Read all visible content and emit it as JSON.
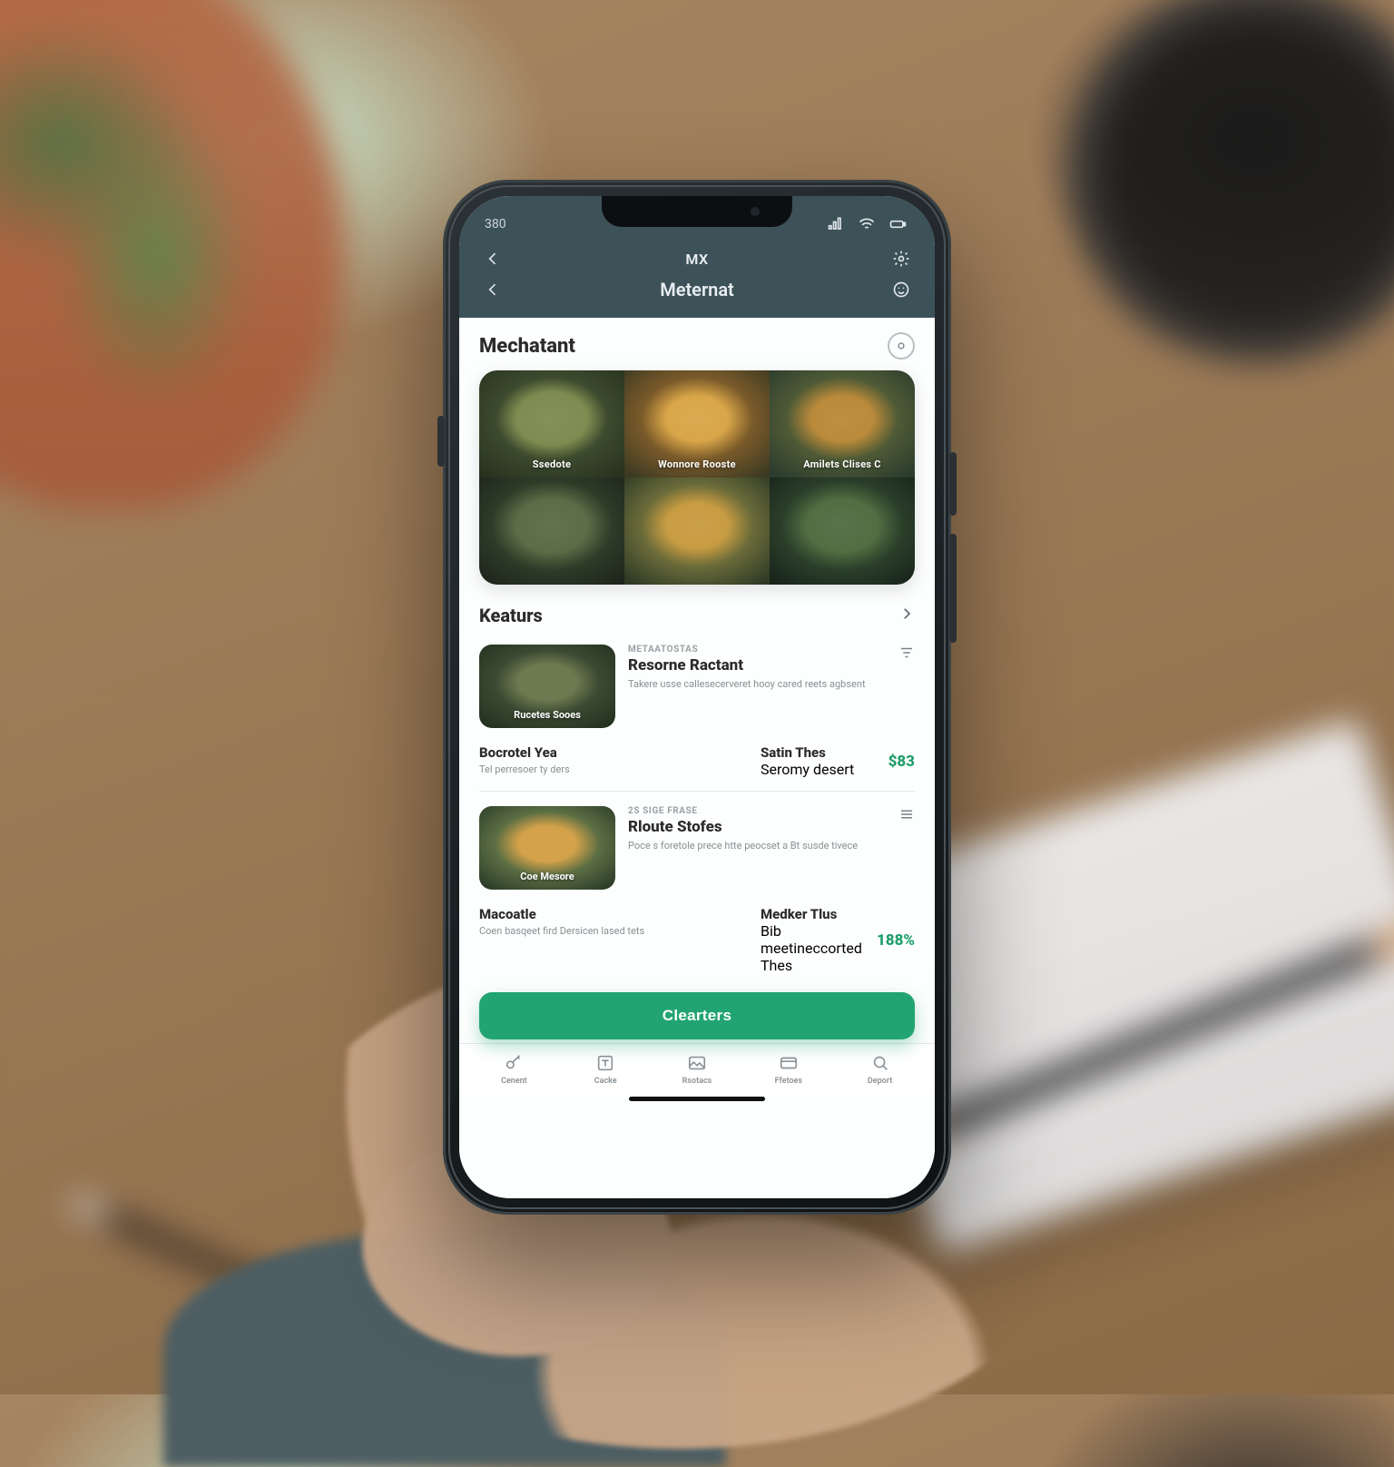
{
  "status": {
    "clock": "380",
    "signal_icon": "signal-icon",
    "wifi_icon": "wifi-icon",
    "battery_icon": "battery-icon"
  },
  "header": {
    "back_icon": "chevron-left-icon",
    "brand_small": "MX",
    "title": "Meternat",
    "settings_icon": "gear-icon",
    "help_icon": "smile-icon"
  },
  "merchant": {
    "heading": "Mechatant",
    "info_icon": "info-circle-icon",
    "gallery": [
      {
        "caption": "Ssedote"
      },
      {
        "caption": "Wonnore Rooste"
      },
      {
        "caption": "Amilets Clises C"
      },
      {
        "caption": ""
      },
      {
        "caption": ""
      },
      {
        "caption": ""
      }
    ]
  },
  "keaturs": {
    "heading": "Keaturs",
    "more_icon": "chevron-right-icon"
  },
  "list": [
    {
      "thumb_caption": "Rucetes Sooes",
      "kicker": "Metaatostas",
      "title": "Resorne Ractant",
      "desc": "Takere usse callesecerveret hooy cared reets agbsent",
      "end_icon": "filter-icon"
    },
    {
      "thumb_caption": "Coe Mesore",
      "kicker": "2S Sige Frase",
      "title": "Rloute Stofes",
      "desc": "Poce s foretole prece htte peocset a Bt susde tivece",
      "end_icon": "menu-icon"
    }
  ],
  "stats": [
    {
      "left_label": "Bocrotel Yea",
      "left_sub": "Tel perresoer ty ders",
      "right_label": "Satin Thes",
      "right_sub": "Seromy desert",
      "price": "$83"
    },
    {
      "left_label": "Macoatle",
      "left_sub": "Coen basqeet fird Dersicen lased tets",
      "right_label": "Medker Tlus",
      "right_sub": "Bib meetineccorted Thes",
      "price": "188%"
    }
  ],
  "cta": {
    "label": "Clearters"
  },
  "tabs": [
    {
      "label": "Cenent",
      "icon": "key-icon"
    },
    {
      "label": "Cacke",
      "icon": "square-t-icon"
    },
    {
      "label": "Rsotacs",
      "icon": "image-icon"
    },
    {
      "label": "Ffetoes",
      "icon": "card-icon"
    },
    {
      "label": "Deport",
      "icon": "search-icon"
    }
  ]
}
